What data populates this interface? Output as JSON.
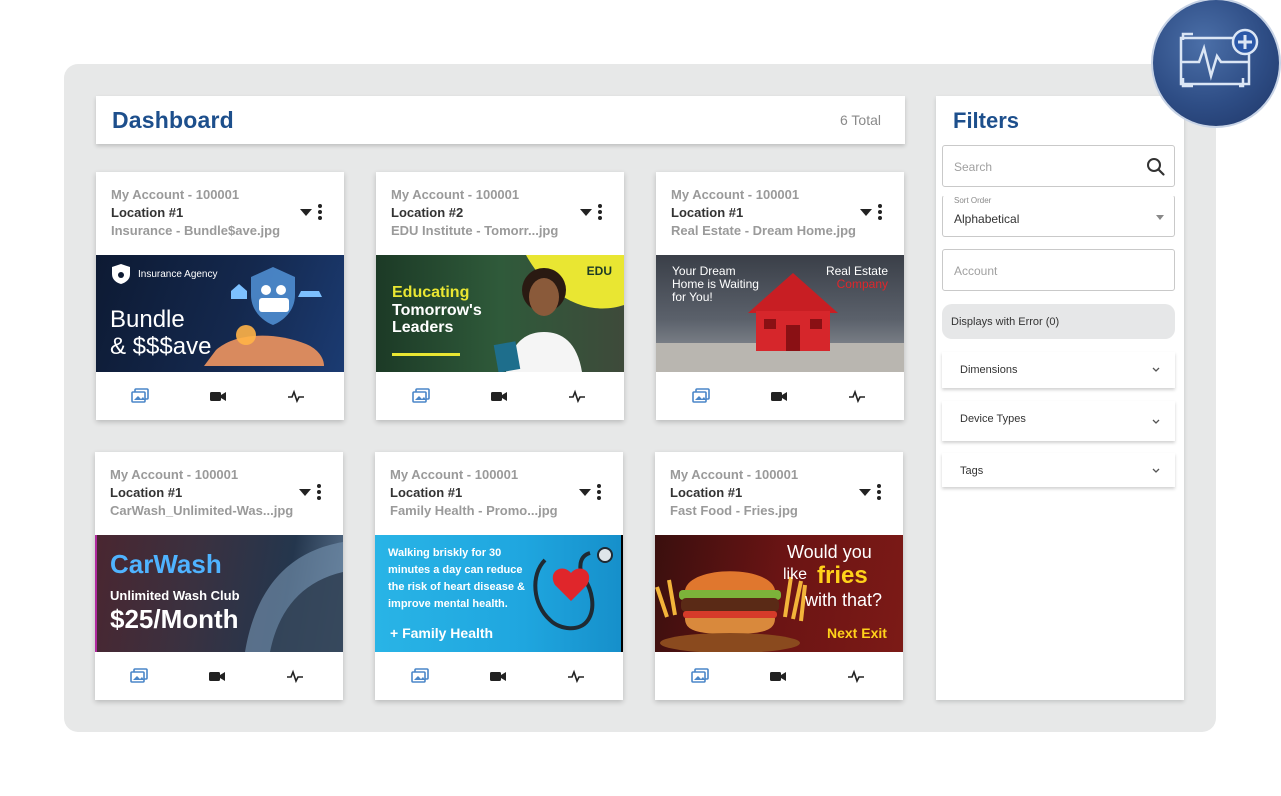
{
  "dashboard": {
    "title": "Dashboard",
    "total": "6 Total"
  },
  "cards": [
    {
      "account": "My Account - 100001",
      "location": "Location #1",
      "file": "Insurance - Bundle$ave.jpg",
      "thumb": {
        "brand": "Insurance Agency",
        "line1": "Bundle",
        "line2": "& $$$ave"
      }
    },
    {
      "account": "My Account - 100001",
      "location": "Location #2",
      "file": "EDU Institute - Tomorr...jpg",
      "thumb": {
        "tag": "EDU",
        "line1": "Educating",
        "line2": "Tomorrow's",
        "line3": "Leaders"
      }
    },
    {
      "account": "My Account - 100001",
      "location": "Location #1",
      "file": "Real Estate - Dream Home.jpg",
      "thumb": {
        "line1": "Your Dream",
        "line2": "Home is Waiting",
        "line3": "for You!",
        "brand1": "Real Estate",
        "brand2": "Company"
      }
    },
    {
      "account": "My Account - 100001",
      "location": "Location #1",
      "file": "CarWash_Unlimited-Was...jpg",
      "thumb": {
        "line1": "CarWash",
        "line2": "Unlimited Wash Club",
        "line3": "$25/Month"
      }
    },
    {
      "account": "My Account - 100001",
      "location": "Location #1",
      "file": "Family Health - Promo...jpg",
      "thumb": {
        "line1": "Walking briskly for 30",
        "line2": "minutes a day can reduce",
        "line3": "the risk of heart disease &",
        "line4": "improve mental health.",
        "brand": "+ Family Health"
      }
    },
    {
      "account": "My Account - 100001",
      "location": "Location #1",
      "file": "Fast Food - Fries.jpg",
      "thumb": {
        "line1": "Would you",
        "line2a": "like",
        "line2b": "fries",
        "line3": "with that?",
        "cta": "Next Exit"
      }
    }
  ],
  "card_icons": [
    "gallery-icon",
    "video-icon",
    "pulse-icon"
  ],
  "filters": {
    "title": "Filters",
    "search_placeholder": "Search",
    "sort_label": "Sort Order",
    "sort_value": "Alphabetical",
    "account_placeholder": "Account",
    "errors_label": "Displays with Error (0)",
    "sections": [
      "Dimensions",
      "Device Types",
      "Tags"
    ]
  },
  "colors": {
    "brand_blue": "#1d4f8c",
    "icon_blue": "#4a86c8",
    "panel_bg": "#e7e8e8"
  }
}
